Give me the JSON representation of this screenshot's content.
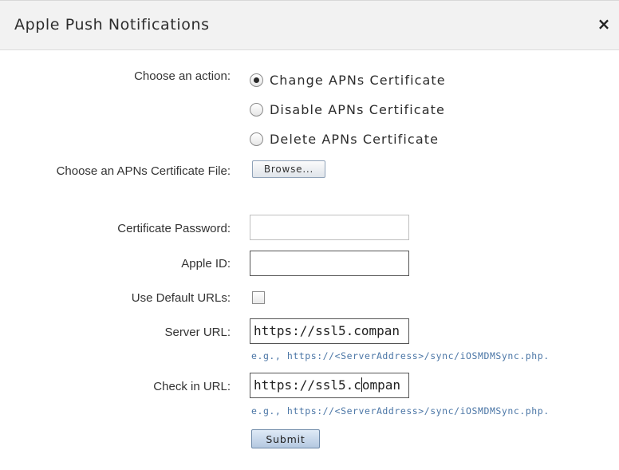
{
  "dialog": {
    "title": "Apple Push Notifications",
    "close_icon": "close-icon",
    "close_glyph": "×"
  },
  "action": {
    "label": "Choose an action:",
    "options": [
      {
        "label": "Change APNs Certificate",
        "checked": true
      },
      {
        "label": "Disable APNs Certificate",
        "checked": false
      },
      {
        "label": "Delete APNs Certificate",
        "checked": false
      }
    ]
  },
  "certificate_file": {
    "label": "Choose an APNs Certificate File:",
    "browse_label": "Browse..."
  },
  "certificate_password": {
    "label": "Certificate Password:",
    "value": ""
  },
  "apple_id": {
    "label": "Apple ID:",
    "value": ""
  },
  "default_urls": {
    "label": "Use Default URLs:",
    "checked": false
  },
  "server_url": {
    "label": "Server URL:",
    "value": "https://ssl5.compan",
    "hint": "e.g., https://<ServerAddress>/sync/iOSMDMSync.php."
  },
  "checkin_url": {
    "label": "Check in URL:",
    "value_before_caret": "https://ssl5.c",
    "value_after_caret": "ompan",
    "hint": "e.g., https://<ServerAddress>/sync/iOSMDMSync.php."
  },
  "submit_label": "Submit"
}
